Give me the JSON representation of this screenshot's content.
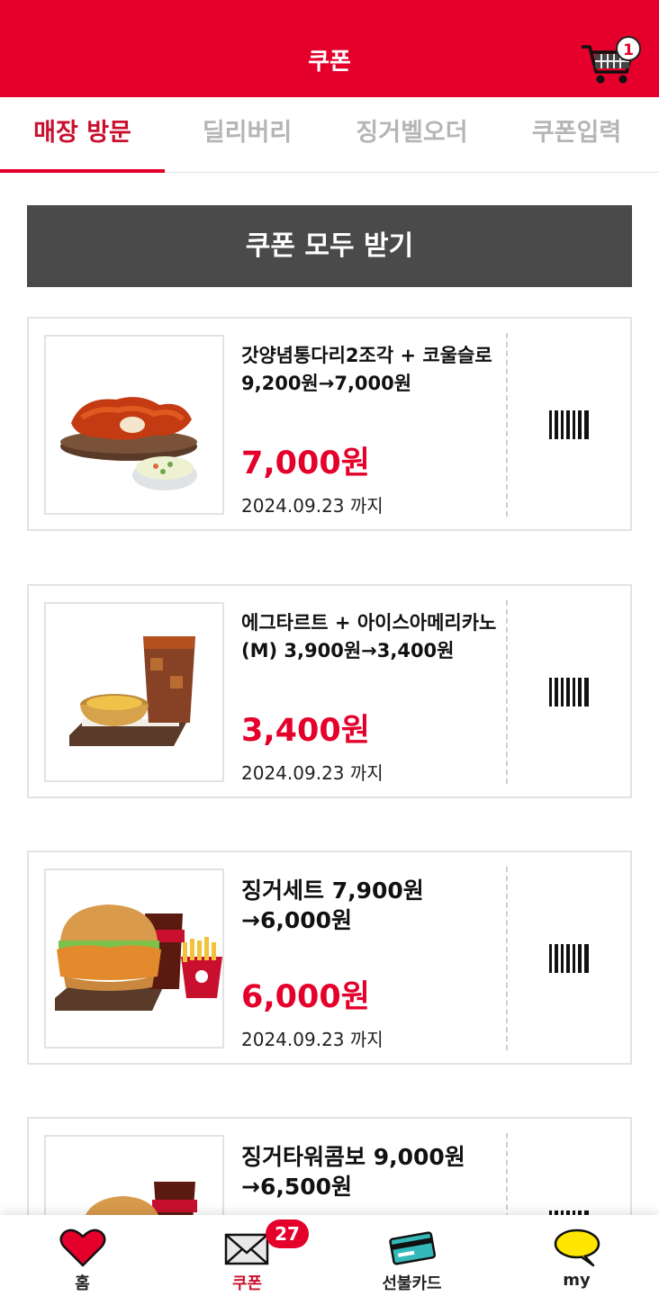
{
  "header": {
    "title": "쿠폰",
    "cart_count": "1"
  },
  "tabs": [
    {
      "label": "매장 방문",
      "active": true
    },
    {
      "label": "딜리버리",
      "active": false
    },
    {
      "label": "징거벨오더",
      "active": false
    },
    {
      "label": "쿠폰입력",
      "active": false
    }
  ],
  "claim_all_label": "쿠폰 모두 받기",
  "coupons": [
    {
      "title": "갓양념통다리2조각 + 코울슬로 9,200원→7,000원",
      "price": "7,000원",
      "expiry": "2024.09.23 까지",
      "image": "spicy-chicken-coleslaw"
    },
    {
      "title": "에그타르트 + 아이스아메리카노 (M) 3,900원→3,400원",
      "price": "3,400원",
      "expiry": "2024.09.23 까지",
      "image": "egg-tart-iced-coffee"
    },
    {
      "title": "징거세트 7,900원 →6,000원",
      "price": "6,000원",
      "expiry": "2024.09.23 까지",
      "image": "zinger-burger-set"
    },
    {
      "title": "징거타워콤보 9,000원 →6,500원",
      "price": "",
      "expiry": "",
      "image": "zinger-tower-combo"
    }
  ],
  "bottom_nav": [
    {
      "label": "홈",
      "icon": "heart-icon",
      "active": false
    },
    {
      "label": "쿠폰",
      "icon": "envelope-icon",
      "active": true,
      "badge": "27"
    },
    {
      "label": "선불카드",
      "icon": "card-icon",
      "active": false
    },
    {
      "label": "my",
      "icon": "speech-bubble-icon",
      "active": false
    }
  ],
  "colors": {
    "brand_red": "#e4002b",
    "dark_button": "#4a4a4a",
    "inactive_tab": "#b5b5b5"
  }
}
